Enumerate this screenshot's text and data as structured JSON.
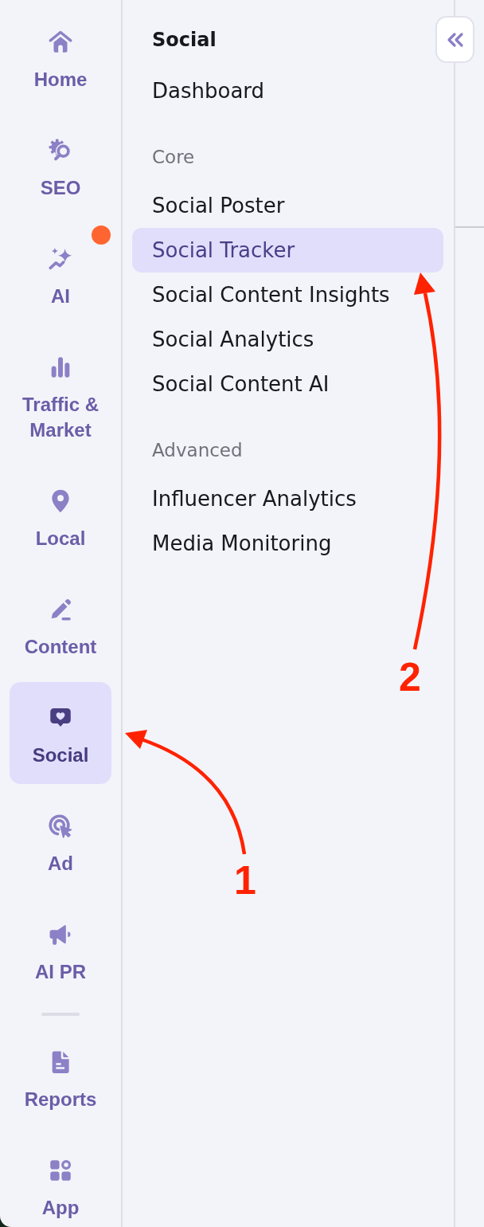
{
  "rail": {
    "items": [
      {
        "label": "Home",
        "selected": false,
        "notification": false
      },
      {
        "label": "SEO",
        "selected": false,
        "notification": false
      },
      {
        "label": "AI",
        "selected": false,
        "notification": true
      },
      {
        "label": "Traffic & Market",
        "selected": false,
        "notification": false
      },
      {
        "label": "Local",
        "selected": false,
        "notification": false
      },
      {
        "label": "Content",
        "selected": false,
        "notification": false
      },
      {
        "label": "Social",
        "selected": true,
        "notification": false
      },
      {
        "label": "Ad",
        "selected": false,
        "notification": false
      },
      {
        "label": "AI PR",
        "selected": false,
        "notification": false
      }
    ],
    "bottom_items": [
      {
        "label": "Reports",
        "selected": false,
        "notification": false
      },
      {
        "label": "App",
        "selected": false,
        "notification": false
      }
    ]
  },
  "panel": {
    "title": "Social",
    "sections": [
      {
        "items": [
          {
            "label": "Dashboard",
            "selected": false
          }
        ]
      },
      {
        "heading": "Core",
        "items": [
          {
            "label": "Social Poster",
            "selected": false
          },
          {
            "label": "Social Tracker",
            "selected": true
          },
          {
            "label": "Social Content Insights",
            "selected": false
          },
          {
            "label": "Social Analytics",
            "selected": false
          },
          {
            "label": "Social Content AI",
            "selected": false
          }
        ]
      },
      {
        "heading": "Advanced",
        "items": [
          {
            "label": "Influencer Analytics",
            "selected": false
          },
          {
            "label": "Media Monitoring",
            "selected": false
          }
        ]
      }
    ]
  },
  "annotations": [
    {
      "label": "1"
    },
    {
      "label": "2"
    }
  ]
}
